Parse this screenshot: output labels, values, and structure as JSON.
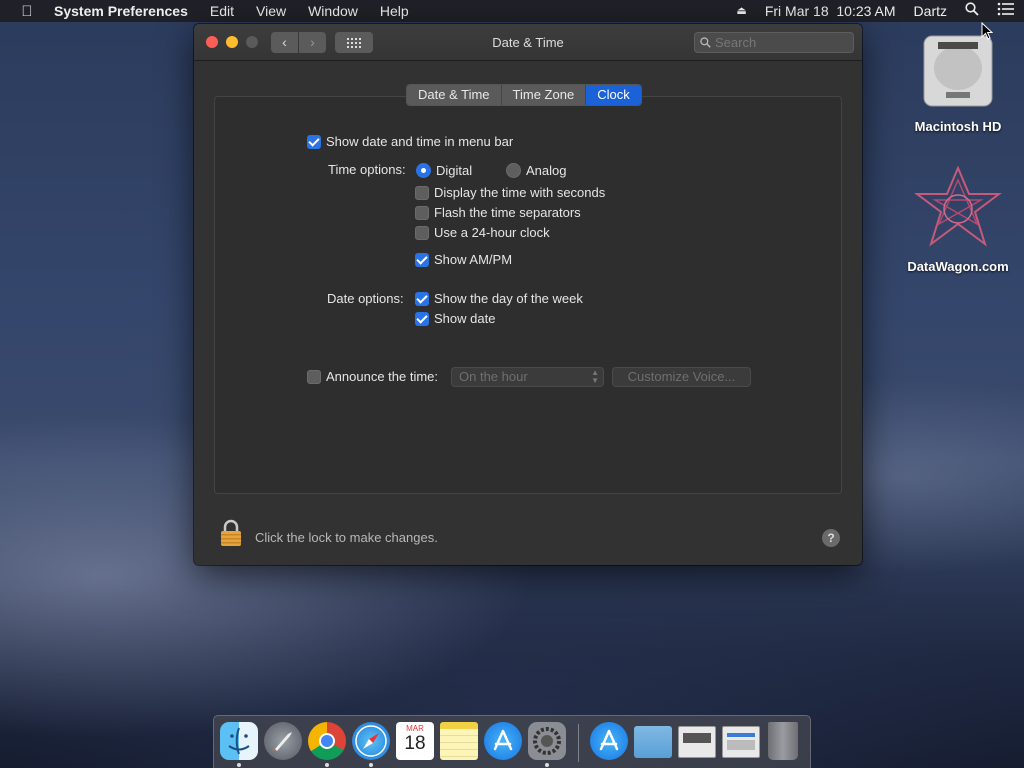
{
  "menubar": {
    "app_name": "System Preferences",
    "items": [
      "Edit",
      "View",
      "Window",
      "Help"
    ],
    "datetime": "Fri Mar 18  10:23 AM",
    "user": "Dartz"
  },
  "window": {
    "title": "Date & Time",
    "search_placeholder": "Search",
    "tabs": [
      {
        "label": "Date & Time",
        "active": false
      },
      {
        "label": "Time Zone",
        "active": false
      },
      {
        "label": "Clock",
        "active": true
      }
    ],
    "clock": {
      "show_in_menubar": {
        "label": "Show date and time in menu bar",
        "checked": true
      },
      "time_options_label": "Time options:",
      "digital": {
        "label": "Digital",
        "selected": true
      },
      "analog": {
        "label": "Analog",
        "selected": false
      },
      "seconds": {
        "label": "Display the time with seconds",
        "checked": false
      },
      "flash": {
        "label": "Flash the time separators",
        "checked": false
      },
      "h24": {
        "label": "Use a 24-hour clock",
        "checked": false
      },
      "ampm": {
        "label": "Show AM/PM",
        "checked": true
      },
      "date_options_label": "Date options:",
      "day_of_week": {
        "label": "Show the day of the week",
        "checked": true
      },
      "show_date": {
        "label": "Show date",
        "checked": true
      },
      "announce": {
        "label": "Announce the time:",
        "checked": false
      },
      "announce_interval": "On the hour",
      "customize_voice": "Customize Voice..."
    },
    "lock_text": "Click the lock to make changes.",
    "help_label": "?"
  },
  "desktop": {
    "icons": [
      {
        "label": "Macintosh HD"
      },
      {
        "label": "DataWagon.com"
      }
    ]
  },
  "dock": {
    "apps": [
      "Finder",
      "Launchpad",
      "Chrome",
      "Safari",
      "Calendar",
      "Notes",
      "App Store",
      "System Preferences",
      "App Store Downloads",
      "Folder",
      "Screenshot 1",
      "Screenshot 2",
      "Trash"
    ],
    "calendar_month": "MAR",
    "calendar_day": "18"
  },
  "colors": {
    "accent": "#2a73e6",
    "tab_active": "#1b62d8",
    "window_bg": "#323232"
  }
}
